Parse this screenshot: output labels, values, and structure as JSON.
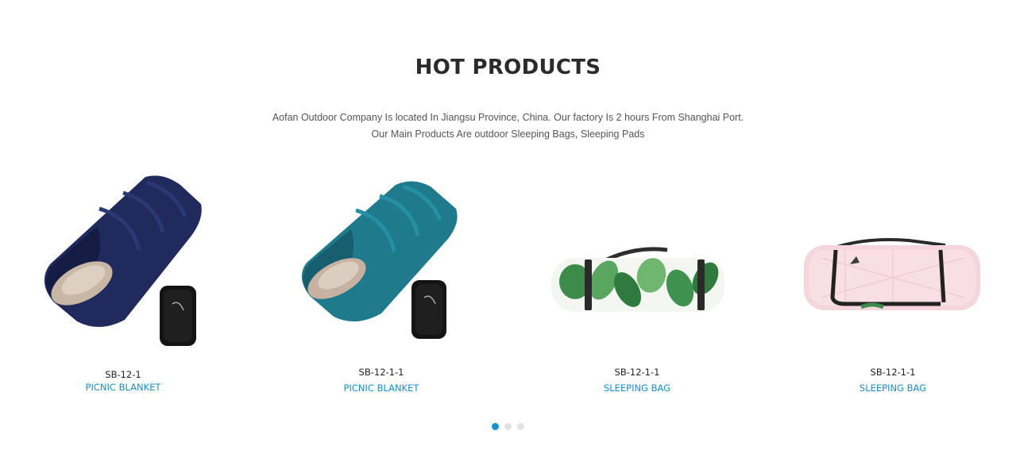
{
  "section": {
    "title": "HOT PRODUCTS",
    "description_line1": "Aofan Outdoor Company Is located In Jiangsu Province, China. Our factory Is 2 hours From Shanghai Port.",
    "description_line2": "Our Main Products Are outdoor Sleeping Bags, Sleeping Pads"
  },
  "products": [
    {
      "code": "SB-12-1",
      "category": "PICNIC BLANKET",
      "image": "navy-sleeping-bag-image"
    },
    {
      "code": "SB-12-1-1",
      "category": "PICNIC BLANKET",
      "image": "teal-sleeping-bag-image"
    },
    {
      "code": "SB-12-1-1",
      "category": "SLEEPING BAG",
      "image": "leaf-pattern-rolled-blanket-image"
    },
    {
      "code": "SB-12-1-1",
      "category": "SLEEPING BAG",
      "image": "pink-rolled-blanket-image"
    }
  ],
  "carousel": {
    "pages": 3,
    "active_page": 1
  },
  "colors": {
    "accent": "#1a8fc9",
    "active_dot": "#1a8fd6",
    "inactive_dot": "#e3e3e3",
    "title": "#2b2b2b"
  }
}
